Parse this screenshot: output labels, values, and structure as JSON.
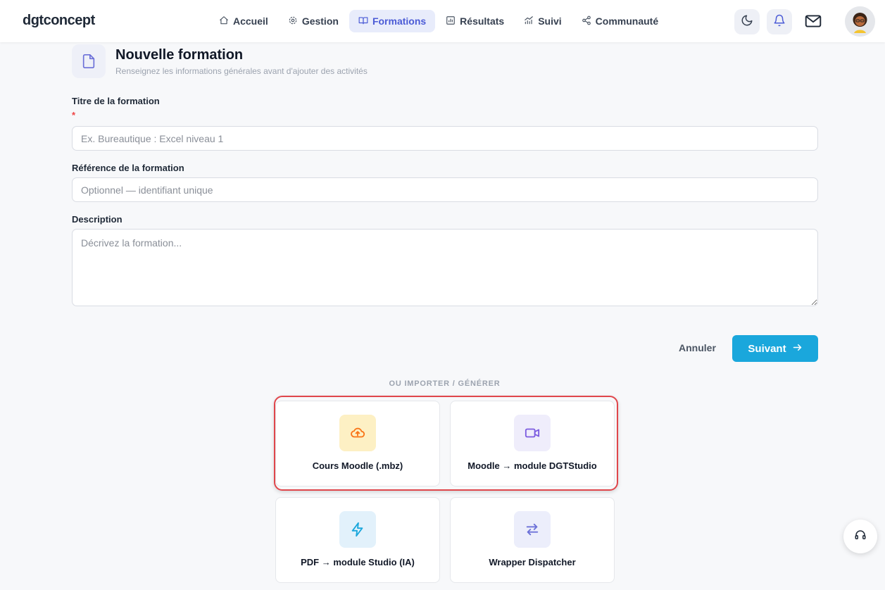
{
  "brand": {
    "name": "dgtconcept"
  },
  "nav": {
    "items": [
      {
        "label": "Accueil",
        "icon": "home-icon"
      },
      {
        "label": "Gestion",
        "icon": "gear-icon"
      },
      {
        "label": "Formations",
        "icon": "book-icon",
        "active": true
      },
      {
        "label": "Résultats",
        "icon": "bar-chart-icon"
      },
      {
        "label": "Suivi",
        "icon": "trend-icon"
      },
      {
        "label": "Communauté",
        "icon": "share-icon"
      }
    ]
  },
  "header_actions": [
    "moon-icon",
    "bell-icon",
    "mail-icon",
    "avatar"
  ],
  "page": {
    "title": "Nouvelle formation",
    "subtitle": "Renseignez les informations générales avant d'ajouter des activités"
  },
  "form": {
    "title_label": "Titre de la formation",
    "required_mark": "*",
    "title_placeholder": "Ex. Bureautique : Excel niveau 1",
    "title_value": "",
    "reference_label": "Référence de la formation",
    "reference_placeholder": "Optionnel — identifiant unique",
    "reference_value": "",
    "description_label": "Description",
    "description_placeholder": "Décrivez la formation...",
    "description_value": "",
    "cancel_label": "Annuler",
    "next_label": "Suivant"
  },
  "import": {
    "heading": "OU IMPORTER / GÉNÉRER",
    "cards": [
      {
        "label": "Cours Moodle (.mbz)",
        "icon": "cloud-upload-icon",
        "color": "#f97316",
        "bg": "#fdf0c4"
      },
      {
        "label": "Moodle → module DGTStudio",
        "icon": "video-icon",
        "color": "#7c5ce0",
        "bg": "#efedfb"
      },
      {
        "label": "PDF → module Studio (IA)",
        "icon": "lightning-icon",
        "color": "#1aa7dc",
        "bg": "#e2f1fb"
      },
      {
        "label": "Wrapper Dispatcher",
        "icon": "swap-icon",
        "color": "#6d72d8",
        "bg": "#eceefb"
      }
    ]
  },
  "colors": {
    "accent": "#1aa7dc",
    "nav_active": "#4b5bd6",
    "highlight": "#e0464b",
    "required": "#ef4444"
  }
}
